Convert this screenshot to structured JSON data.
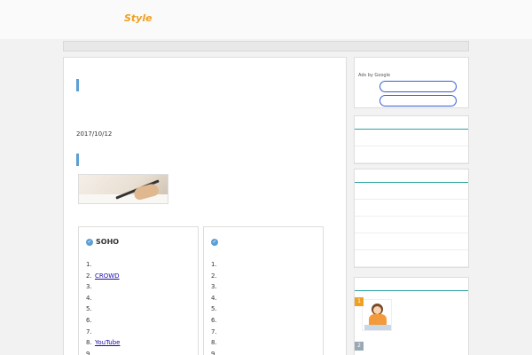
{
  "header": {
    "logo_jp": "",
    "logo_style": "Style",
    "logo_sub": ""
  },
  "article": {
    "title": "",
    "intro": "",
    "date_label": "",
    "date_value": "2017/10/12",
    "section_title": "",
    "section_text": "",
    "box_left": {
      "title": "SOHO",
      "items": [
        {
          "num": "1.",
          "label": ""
        },
        {
          "num": "2.",
          "label": "CROWD"
        },
        {
          "num": "3.",
          "label": ""
        },
        {
          "num": "4.",
          "label": ""
        },
        {
          "num": "5.",
          "label": ""
        },
        {
          "num": "6.",
          "label": ""
        },
        {
          "num": "7.",
          "label": ""
        },
        {
          "num": "8.",
          "label": "YouTube"
        },
        {
          "num": "9.",
          "label": ""
        }
      ]
    },
    "box_right": {
      "title": "",
      "items": [
        {
          "num": "1.",
          "label": ""
        },
        {
          "num": "2.",
          "label": ""
        },
        {
          "num": "3.",
          "label": ""
        },
        {
          "num": "4.",
          "label": ""
        },
        {
          "num": "5.",
          "label": ""
        },
        {
          "num": "6.",
          "label": ""
        },
        {
          "num": "7.",
          "label": ""
        },
        {
          "num": "8.",
          "label": ""
        },
        {
          "num": "9.",
          "label": ""
        }
      ]
    }
  },
  "sidebar": {
    "ads": {
      "title": "",
      "adsby": "Ads by Google",
      "btn1": "",
      "btn2": ""
    },
    "cat1": {
      "title": "",
      "items": [
        "",
        ""
      ]
    },
    "cat2": {
      "title": "",
      "items": [
        "",
        "",
        "",
        "",
        ""
      ]
    },
    "ranking": {
      "title": "",
      "items": [
        {
          "rank": "1",
          "title": "",
          "desc": ""
        },
        {
          "rank": "2",
          "title": "",
          "desc": ""
        }
      ]
    }
  },
  "colors": {
    "accent_blue": "#5b9fd6",
    "link": "#1a0dab",
    "teal": "#2ea3a3",
    "orange": "#f0a020"
  }
}
